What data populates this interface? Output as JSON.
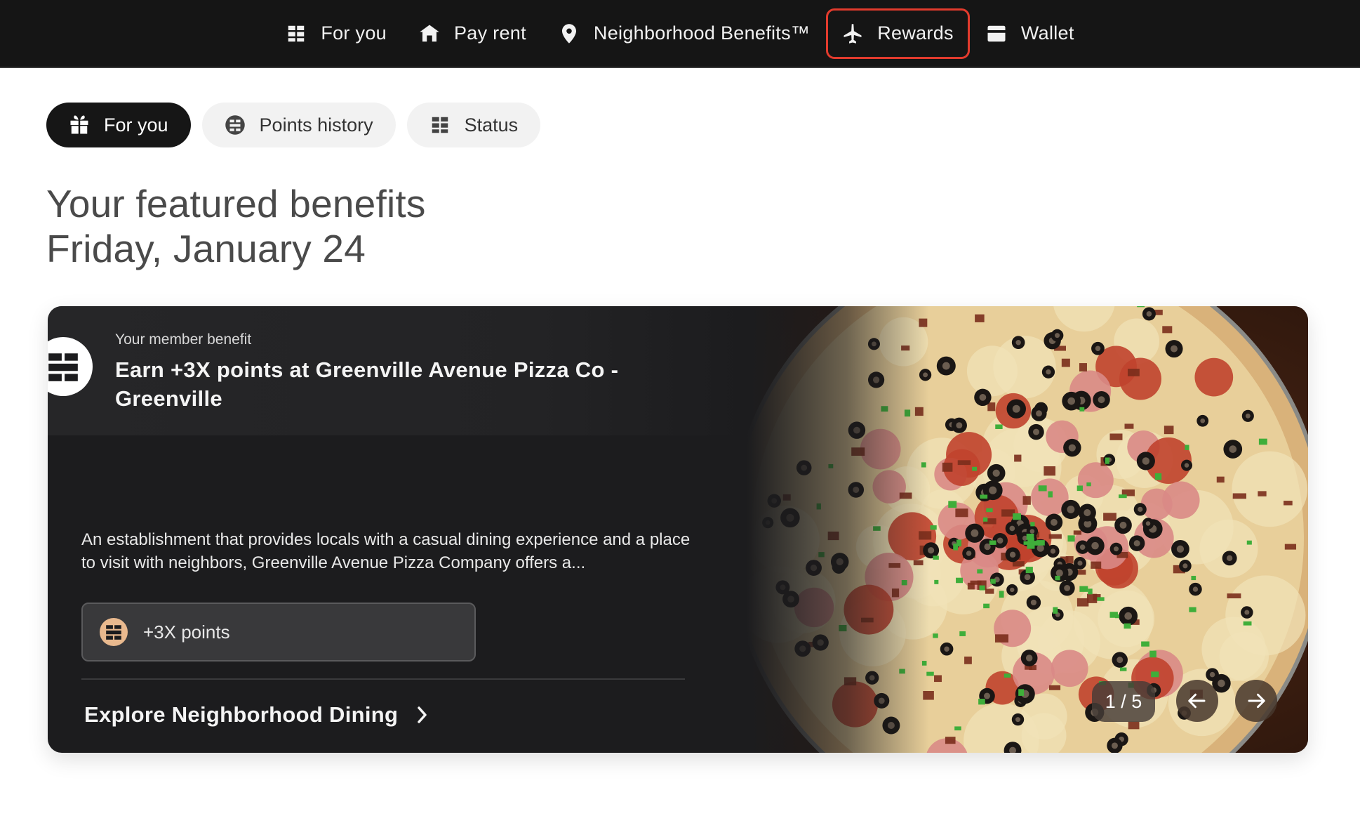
{
  "nav": {
    "items": [
      {
        "label": "For you",
        "icon": "grid-icon",
        "active": false
      },
      {
        "label": "Pay rent",
        "icon": "home-icon",
        "active": false
      },
      {
        "label": "Neighborhood Benefits™",
        "icon": "location-pin-icon",
        "active": false
      },
      {
        "label": "Rewards",
        "icon": "airplane-icon",
        "active": true
      },
      {
        "label": "Wallet",
        "icon": "card-icon",
        "active": false
      }
    ],
    "active_border_color": "#e23b2d"
  },
  "subtabs": [
    {
      "label": "For you",
      "icon": "gift-icon",
      "active": true
    },
    {
      "label": "Points history",
      "icon": "points-coin-icon",
      "active": false
    },
    {
      "label": "Status",
      "icon": "grid-icon",
      "active": false
    }
  ],
  "headline": {
    "line1": "Your featured benefits",
    "line2": "Friday, January 24"
  },
  "card": {
    "eyebrow": "Your member benefit",
    "title": "Earn +3X points at Greenville Avenue Pizza Co - Greenville",
    "description": "An establishment that provides locals with a casual dining experience and a place to visit with neighbors, Greenville Avenue Pizza Company offers a...",
    "points_label": "+3X points",
    "explore_label": "Explore Neighborhood Dining",
    "pager": "1 / 5",
    "image": "pizza-photo"
  }
}
